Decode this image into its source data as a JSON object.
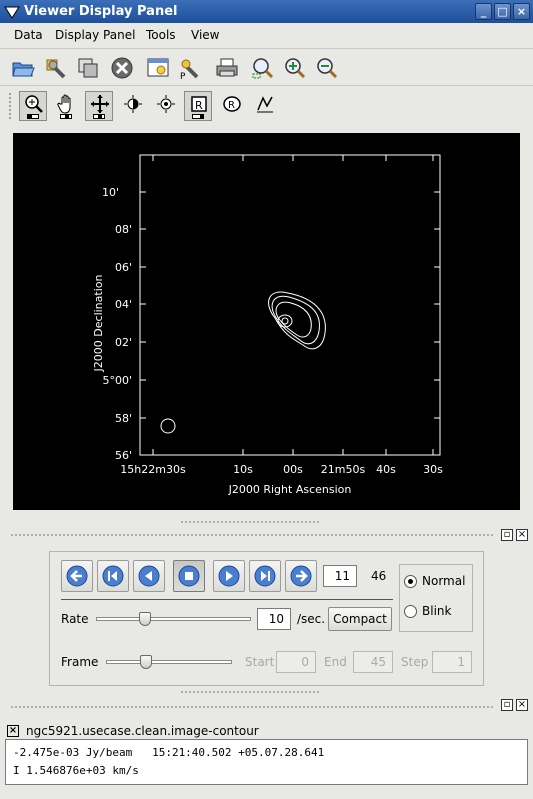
{
  "window": {
    "title": "Viewer Display Panel",
    "buttons": [
      "_",
      "□",
      "×"
    ]
  },
  "menu": [
    {
      "label": "Data"
    },
    {
      "label": "Display Panel"
    },
    {
      "label": "Tools"
    },
    {
      "label": "View"
    }
  ],
  "toolbar_icons": [
    "open-folder-icon",
    "data-options-icon",
    "new-panel-icon",
    "close-panel-icon",
    "panel-options-icon",
    "print-options-icon",
    "print-icon",
    "zoom-fit-icon",
    "zoom-in-icon",
    "zoom-out-icon"
  ],
  "mouse_tools": [
    "zoom-tool-icon",
    "pan-tool-icon",
    "crosshair-move-icon",
    "contrast-tool-icon",
    "shift-colormap-icon",
    "crosshair-point-icon",
    "rectangle-region-icon",
    "polygon-region-icon",
    "polyline-icon"
  ],
  "plot": {
    "x_axis_label": "J2000 Right Ascension",
    "y_axis_label": "J2000 Declination",
    "x_ticks": [
      "15h22m30s",
      "10s",
      "00s",
      "21m50s",
      "40s",
      "30s"
    ],
    "y_ticks": [
      "10'",
      "08'",
      "06'",
      "04'",
      "02'",
      "5°00'",
      "58'",
      "56'"
    ],
    "colors": {
      "background": "#000000",
      "foreground": "#ffffff"
    }
  },
  "animator": {
    "current_frame": "11",
    "total_frames": "46",
    "rate_label": "Rate",
    "rate_value": "10",
    "rate_unit": "/sec.",
    "compact_label": "Compact",
    "frame_label": "Frame",
    "start_label": "Start",
    "start_value": "0",
    "end_label": "End",
    "end_value": "45",
    "step_label": "Step",
    "step_value": "1",
    "mode_normal": "Normal",
    "mode_blink": "Blink",
    "selected_mode": "Normal",
    "rate_slider_fraction": 0.3,
    "frame_slider_fraction": 0.3,
    "nav_icons": [
      "rewind-to-start-icon",
      "step-first-icon",
      "step-back-icon",
      "stop-icon",
      "play-forward-icon",
      "step-last-icon",
      "forward-to-end-icon"
    ]
  },
  "tracking": {
    "title": "ngc5921.usecase.clean.image-contour",
    "line1": "-2.475e-03 Jy/beam   15:21:40.502 +05.07.28.641",
    "line2": "I 1.546876e+03 km/s"
  }
}
